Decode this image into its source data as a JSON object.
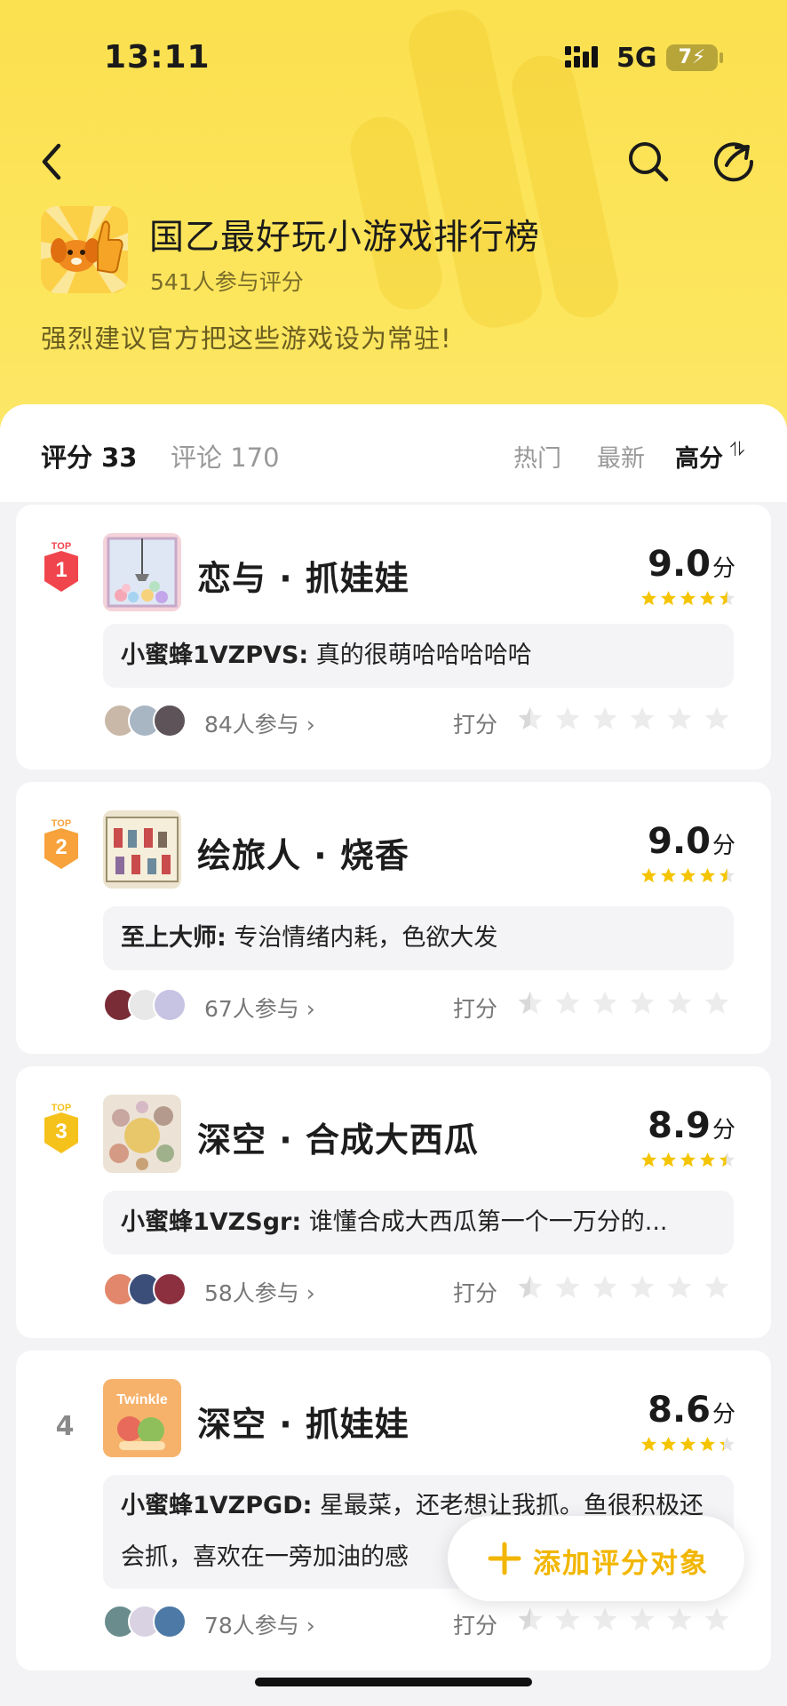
{
  "status": {
    "time": "13:11",
    "network": "5G",
    "battery": "7"
  },
  "header": {
    "title": "国乙最好玩小游戏排行榜",
    "participants": "541人参与评分",
    "subtitle": "强烈建议官方把这些游戏设为常驻!"
  },
  "tabs": {
    "score": "评分 33",
    "comment": "评论 170"
  },
  "sort": {
    "hot": "热门",
    "new": "最新",
    "high": "高分",
    "high_icon": "⥮"
  },
  "rank_badge_label": "TOP",
  "rate_label": "打分",
  "score_unit": "分",
  "items": [
    {
      "rank": "1",
      "name": "恋与 · 抓娃娃",
      "score": "9.0",
      "score_value": 9.0,
      "commenter": "小蜜蜂1VZPVS:",
      "comment": "真的很萌哈哈哈哈哈",
      "joined": "84人参与 ›",
      "badge_color": "#f0454d"
    },
    {
      "rank": "2",
      "name": "绘旅人 · 烧香",
      "score": "9.0",
      "score_value": 9.0,
      "commenter": "至上大师:",
      "comment": "专治情绪内耗，色欲大发",
      "joined": "67人参与 ›",
      "badge_color": "#f7a23b"
    },
    {
      "rank": "3",
      "name": "深空 · 合成大西瓜",
      "score": "8.9",
      "score_value": 8.9,
      "commenter": "小蜜蜂1VZSgr:",
      "comment": "谁懂合成大西瓜第一个一万分的...",
      "joined": "58人参与 ›",
      "badge_color": "#f5c11b"
    },
    {
      "rank": "4",
      "name": "深空 · 抓娃娃",
      "score": "8.6",
      "score_value": 8.6,
      "commenter": "小蜜蜂1VZPGD:",
      "comment": "星最菜，还老想让我抓。鱼很积极还会抓，喜欢在一旁加油的感",
      "joined": "78人参与 ›",
      "badge_color": ""
    }
  ],
  "thumb4_text": "Twinkle",
  "fab": {
    "label": "添加评分对象"
  },
  "colors": {
    "accent": "#f2b600",
    "header_yellow": "#fbe04f",
    "star": "#f5c400"
  }
}
